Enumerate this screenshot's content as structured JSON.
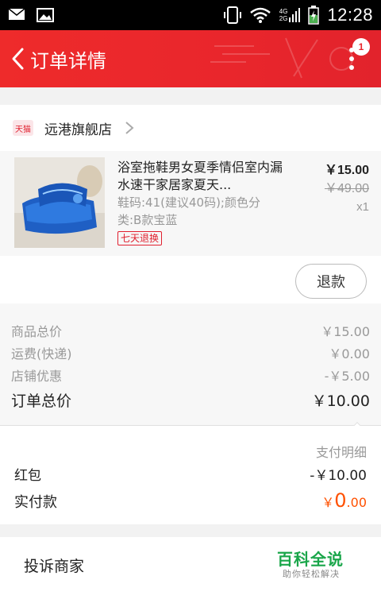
{
  "status_bar": {
    "time": "12:28",
    "network_label_top": "4G",
    "network_label_bottom": "2G"
  },
  "nav": {
    "title": "订单详情",
    "badge_count": "1"
  },
  "shop": {
    "platform_tag": "天猫",
    "name": "远港旗舰店"
  },
  "product": {
    "title": "浴室拖鞋男女夏季情侣室内漏水速干家居家夏天...",
    "spec": "鞋码:41(建议40码);颜色分类:B款宝蓝",
    "service_tag": "七天退换",
    "price": "￥15.00",
    "original_price": "￥49.00",
    "quantity": "x1",
    "refund_label": "退款"
  },
  "summary": {
    "items": [
      {
        "label": "商品总价",
        "value": "￥15.00"
      },
      {
        "label": "运费(快递)",
        "value": "￥0.00"
      },
      {
        "label": "店铺优惠",
        "value": "-￥5.00"
      }
    ],
    "total_label": "订单总价",
    "total_value": "￥10.00"
  },
  "payment": {
    "detail_label": "支付明细",
    "hongbao_label": "红包",
    "hongbao_value": "-￥10.00",
    "paid_label": "实付款",
    "paid_symbol": "￥",
    "paid_int": "0",
    "paid_dec": ".00"
  },
  "bottom": {
    "complain_label": "投诉商家"
  },
  "watermark": {
    "main": "百科全说",
    "sub": "助你轻松解决"
  },
  "colors": {
    "brand_red": "#e9262c",
    "accent_orange": "#ff5000",
    "watermark_green": "#1aa64a"
  }
}
